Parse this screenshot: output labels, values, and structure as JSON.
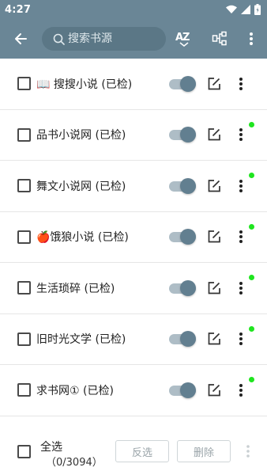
{
  "status_bar": {
    "time": "4:27"
  },
  "toolbar": {
    "search_placeholder": "搜索书源",
    "sort_label": "AZ"
  },
  "sources": [
    {
      "name": "📖 搜搜小说 (已检)",
      "enabled": true,
      "has_dot": false
    },
    {
      "name": "品书小说网 (已检)",
      "enabled": true,
      "has_dot": true
    },
    {
      "name": "舞文小说网 (已检)",
      "enabled": true,
      "has_dot": true
    },
    {
      "name": "🍎饿狼小说 (已检)",
      "enabled": true,
      "has_dot": true
    },
    {
      "name": "生活琐碎 (已检)",
      "enabled": true,
      "has_dot": true
    },
    {
      "name": "旧时光文学 (已检)",
      "enabled": true,
      "has_dot": true
    },
    {
      "name": "求书网① (已检)",
      "enabled": true,
      "has_dot": true
    }
  ],
  "bottom_bar": {
    "select_all_label": "全选",
    "selection_count": "（0/3094）",
    "invert_label": "反选",
    "delete_label": "删除"
  },
  "colors": {
    "toolbar_bg": "#6a8696",
    "switch_thumb": "#627f90",
    "switch_track": "#aebdc6",
    "dot_green": "#1fe51f"
  }
}
